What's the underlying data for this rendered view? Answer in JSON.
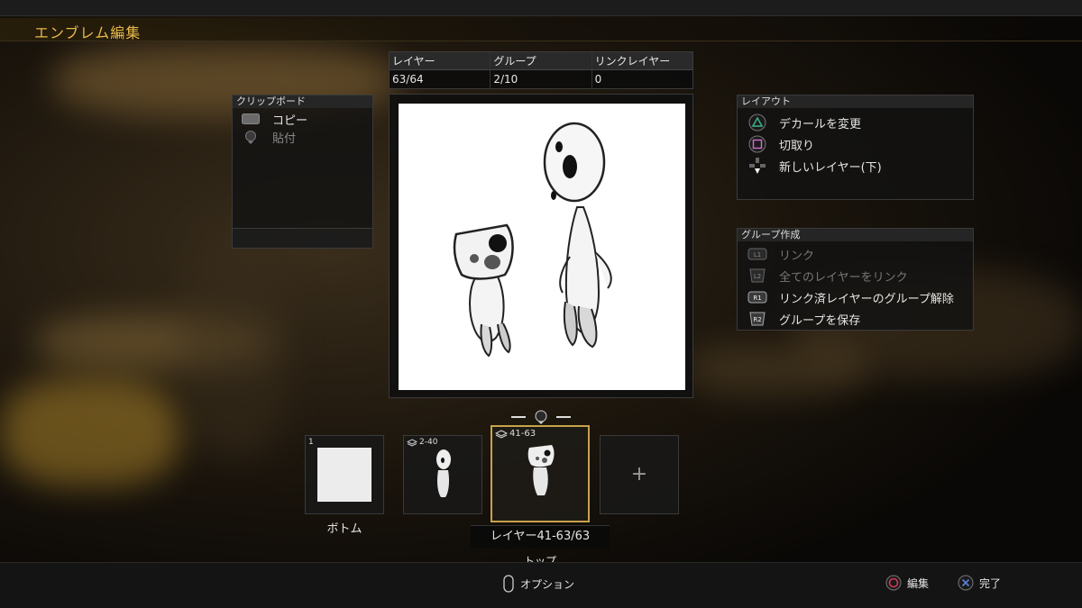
{
  "header": {
    "title": "エンブレム編集"
  },
  "stats": {
    "headers": [
      "レイヤー",
      "グループ",
      "リンクレイヤー"
    ],
    "values": [
      "63/64",
      "2/10",
      "0"
    ]
  },
  "clipboard": {
    "title": "クリップボード",
    "items": [
      {
        "label": "コピー",
        "icon": "touchpad-icon"
      },
      {
        "label": "貼付",
        "icon": "r3-icon"
      }
    ]
  },
  "layout": {
    "title": "レイアウト",
    "items": [
      {
        "label": "デカールを変更",
        "icon": "triangle-button-icon"
      },
      {
        "label": "切取り",
        "icon": "square-button-icon"
      },
      {
        "label": "新しいレイヤー(下)",
        "icon": "dpad-down-icon"
      }
    ]
  },
  "group": {
    "title": "グループ作成",
    "items": [
      {
        "label": "リンク",
        "button": "L1",
        "enabled": false
      },
      {
        "label": "全てのレイヤーをリンク",
        "button": "L2",
        "enabled": false
      },
      {
        "label": "リンク済レイヤーのグループ解除",
        "button": "R1",
        "enabled": true
      },
      {
        "label": "グループを保存",
        "button": "R2",
        "enabled": true
      }
    ]
  },
  "layers": {
    "bottom_number": "1",
    "bottom_label": "ボトム",
    "group1_range": "2-40",
    "group2_range": "41-63",
    "selected_caption": "レイヤー41-63/63",
    "top_label": "トップ",
    "add_symbol": "+"
  },
  "footer": {
    "options": "オプション",
    "edit": "編集",
    "done": "完了"
  },
  "colors": {
    "accent": "#e8b94a",
    "selected_border": "#c9a24a",
    "circle": "#d9365a",
    "cross": "#5b7fd6",
    "triangle": "#3bb58a",
    "square": "#c86ac8"
  }
}
